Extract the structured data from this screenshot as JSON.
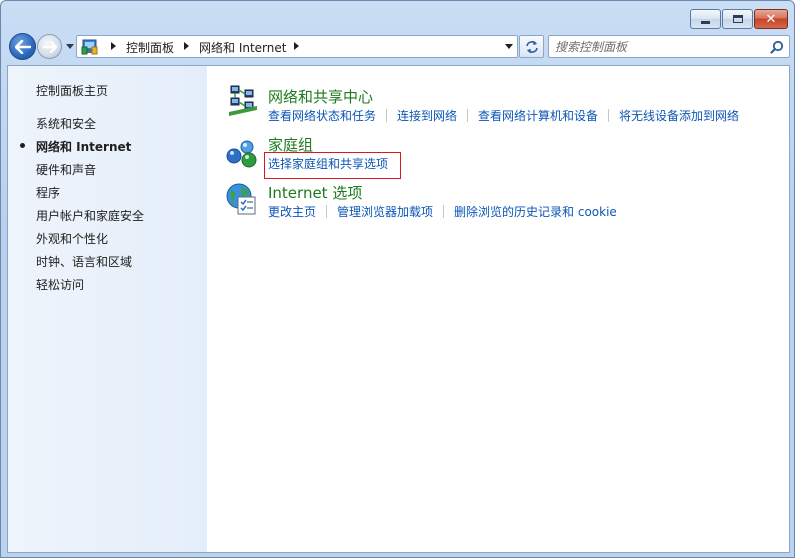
{
  "window": {
    "caption": {
      "minimize_icon": "minimize-icon",
      "maximize_icon": "maximize-icon",
      "close_icon": "close-icon",
      "close_glyph": "✕"
    }
  },
  "navigation": {
    "back_icon": "back-arrow-icon",
    "forward_icon": "forward-arrow-icon",
    "recent_pages_icon": "chevron-down-icon",
    "breadcrumbs": [
      "控制面板",
      "网络和 Internet"
    ],
    "refresh_icon": "refresh-icon",
    "search_placeholder": "搜索控制面板",
    "search_icon": "search-icon"
  },
  "sidebar": {
    "home_label": "控制面板主页",
    "items": [
      {
        "label": "系统和安全",
        "active": false
      },
      {
        "label": "网络和 Internet",
        "active": true
      },
      {
        "label": "硬件和声音",
        "active": false
      },
      {
        "label": "程序",
        "active": false
      },
      {
        "label": "用户帐户和家庭安全",
        "active": false
      },
      {
        "label": "外观和个性化",
        "active": false
      },
      {
        "label": "时钟、语言和区域",
        "active": false
      },
      {
        "label": "轻松访问",
        "active": false
      }
    ]
  },
  "categories": [
    {
      "title": "网络和共享中心",
      "icon": "network-sharing-center-icon",
      "links": [
        "查看网络状态和任务",
        "连接到网络",
        "查看网络计算机和设备",
        "将无线设备添加到网络"
      ]
    },
    {
      "title": "家庭组",
      "icon": "homegroup-icon",
      "links": [
        "选择家庭组和共享选项"
      ]
    },
    {
      "title": "Internet 选项",
      "icon": "internet-options-icon",
      "links": [
        "更改主页",
        "管理浏览器加载项",
        "删除浏览的历史记录和 cookie"
      ]
    }
  ],
  "colors": {
    "category_title": "#1e7a1e",
    "link": "#0b56b6",
    "highlight_border": "#d7181e"
  }
}
